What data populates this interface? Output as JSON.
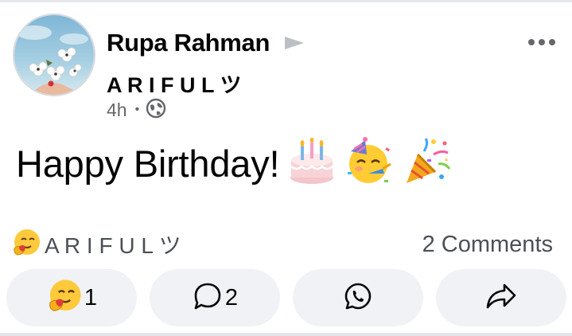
{
  "post": {
    "author": "Rupa Rahman",
    "target": "A R I F U L ツ",
    "time": "4h",
    "visibility_icon": "globe-icon",
    "text": "Happy Birthday!",
    "emojis": [
      "birthday-cake-icon",
      "partying-face-icon",
      "party-popper-icon"
    ]
  },
  "reactions": {
    "summary_icon": "hug-emoji-icon",
    "reactor": "A R I F U L ツ",
    "comments_label": "2 Comments"
  },
  "actions": {
    "react_count": "1",
    "comment_count": "2",
    "whatsapp_icon": "whatsapp-icon",
    "share_icon": "share-icon"
  },
  "colors": {
    "secondary_text": "#65676b",
    "button_bg": "#f0f2f5",
    "divider": "#e4e6eb"
  }
}
